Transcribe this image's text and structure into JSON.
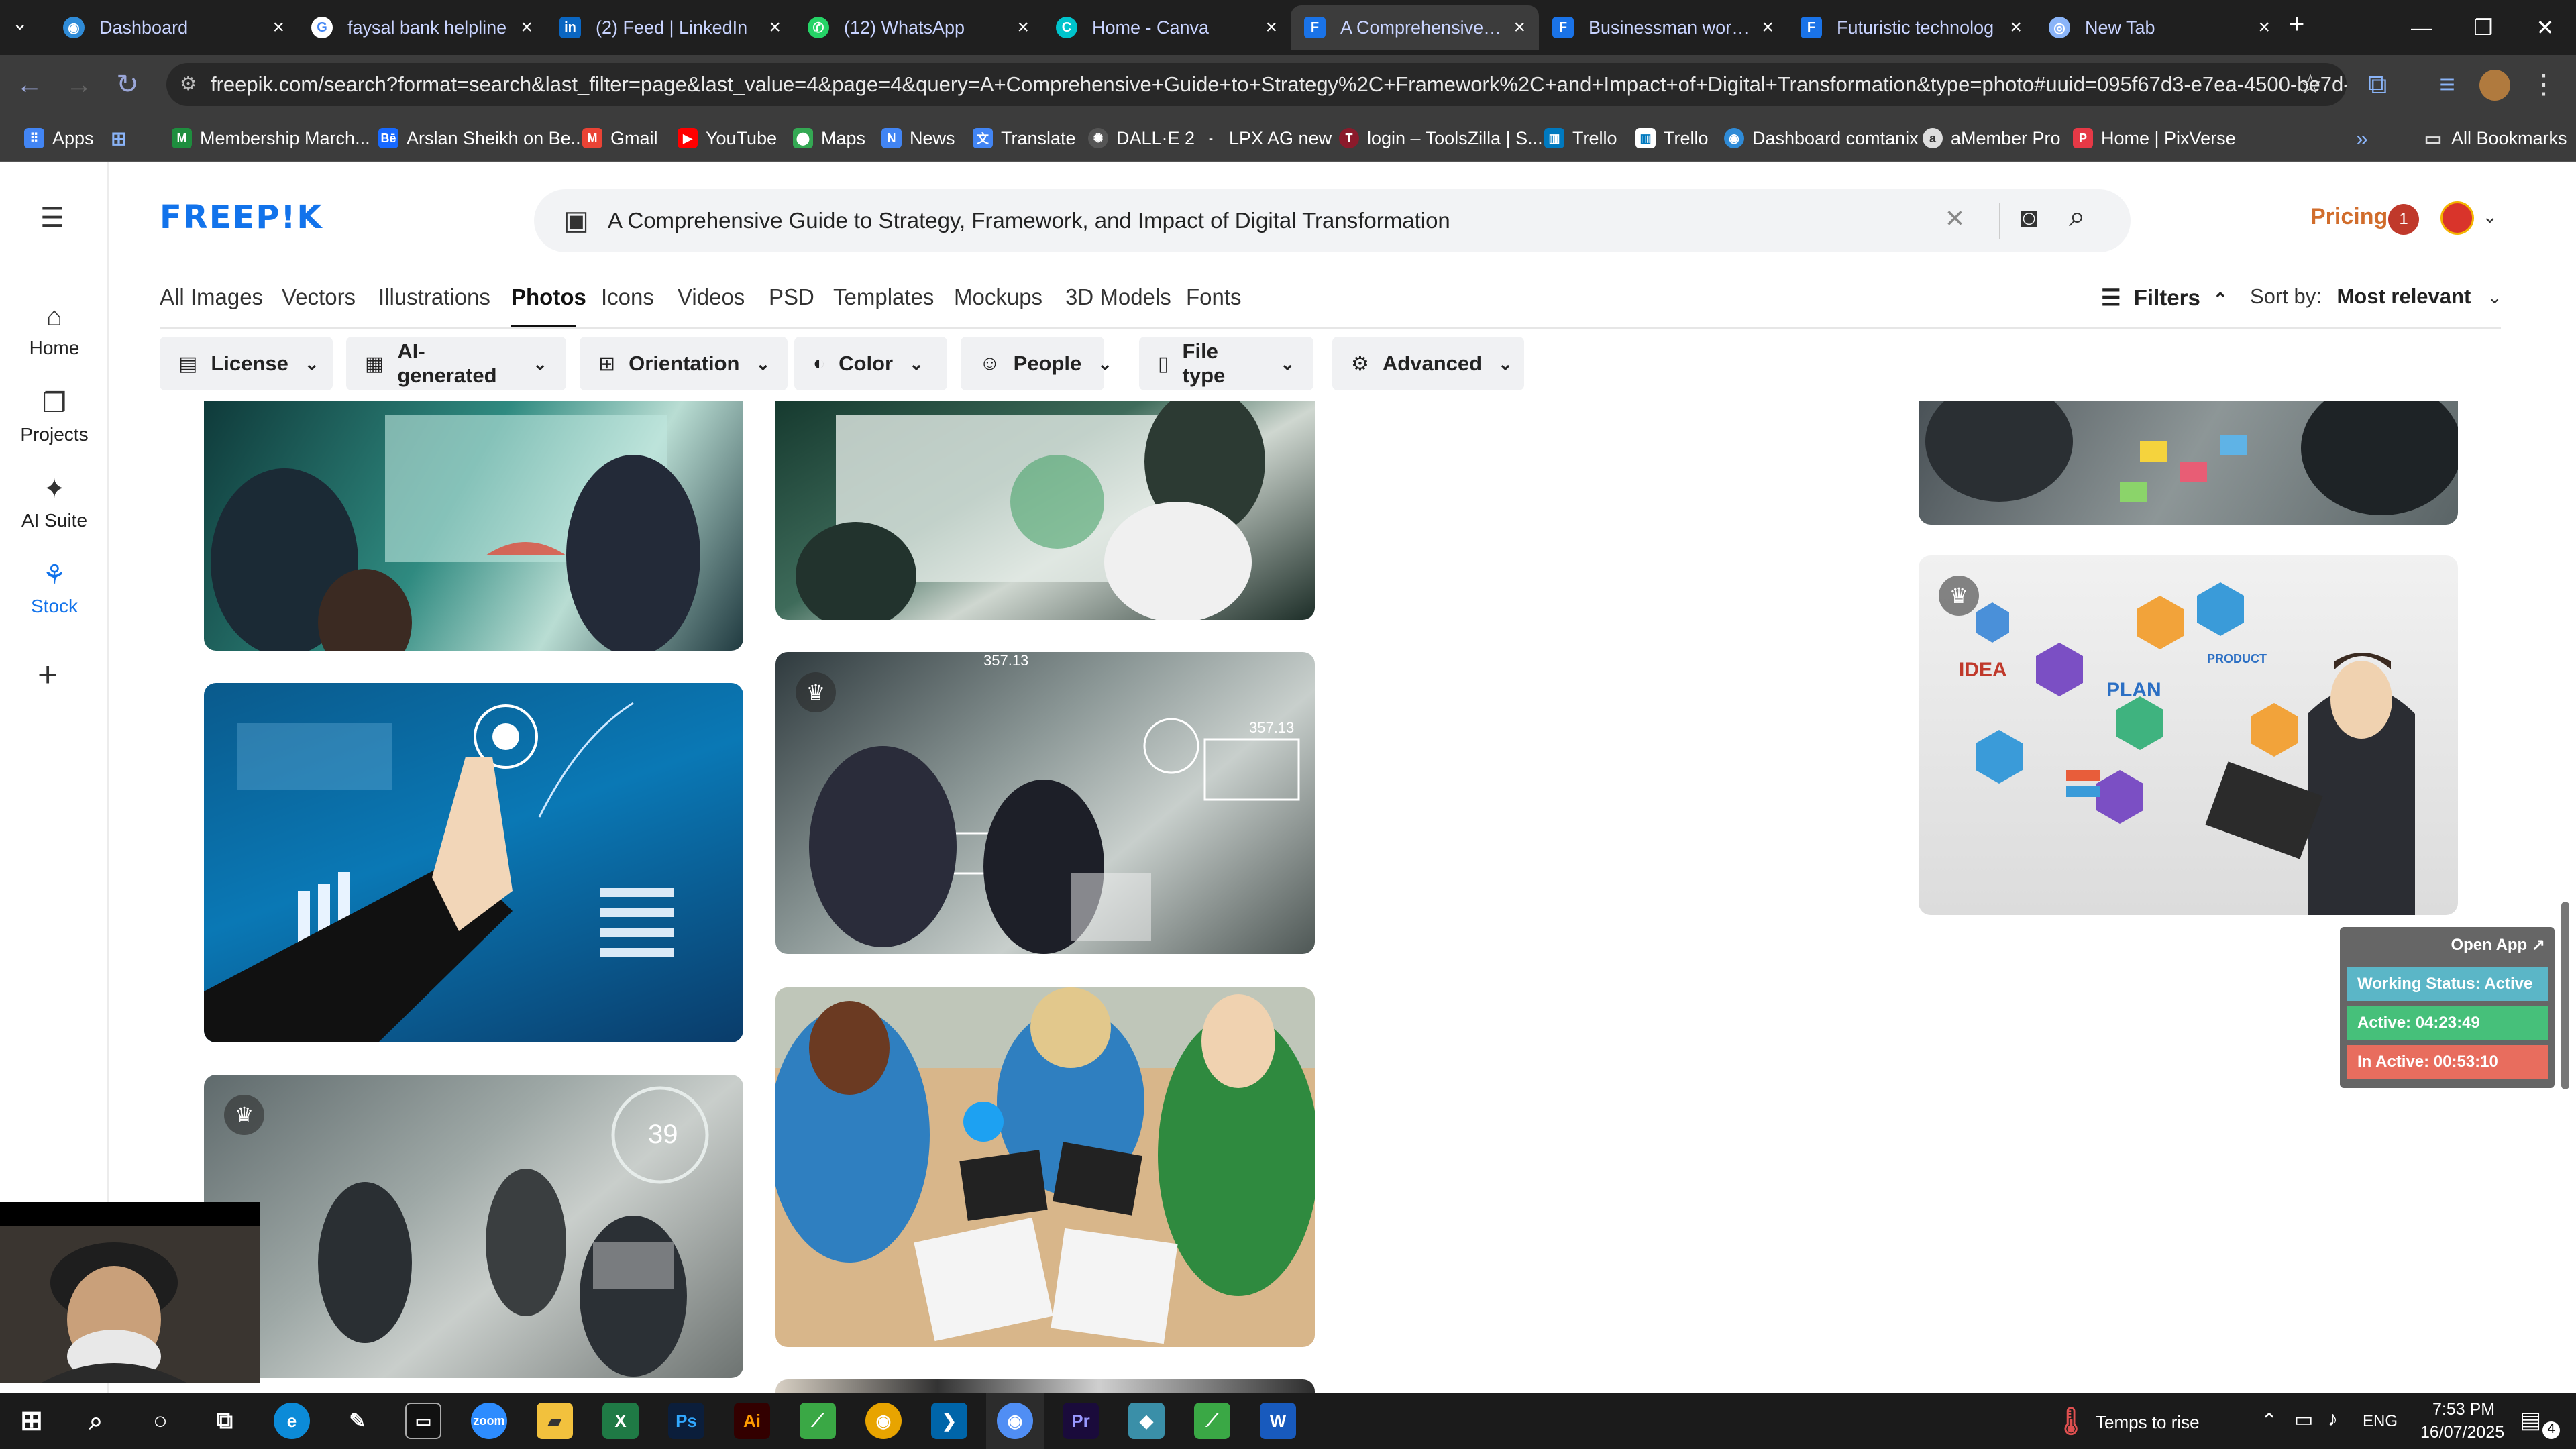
{
  "browser": {
    "tabs": [
      {
        "title": "Dashboard",
        "icon": "dashboard-icon",
        "color": "#2f8bd7"
      },
      {
        "title": "faysal bank helpline",
        "icon": "google-icon",
        "color": "#4285f4"
      },
      {
        "title": "(2) Feed | LinkedIn",
        "icon": "linkedin-icon",
        "color": "#0a66c2"
      },
      {
        "title": "(12) WhatsApp",
        "icon": "whatsapp-icon",
        "color": "#25d366"
      },
      {
        "title": "Home - Canva",
        "icon": "canva-icon",
        "color": "#00c4cc"
      },
      {
        "title": "A Comprehensive Gu",
        "icon": "docs-icon",
        "color": "#1a73e8"
      },
      {
        "title": "Businessman working",
        "icon": "docs-icon",
        "color": "#1a73e8"
      },
      {
        "title": "Futuristic technolog",
        "icon": "docs-icon",
        "color": "#1a73e8"
      },
      {
        "title": "New Tab",
        "icon": "chrome-icon",
        "color": "#8ab4f8"
      }
    ],
    "url": "freepik.com/search?format=search&last_filter=page&last_value=4&page=4&query=A+Comprehensive+Guide+to+Strategy%2C+Framework%2C+and+Impact+of+Digital+Transformation&type=photo#uuid=095f67d3-e7ea-4500-be7d-a48bfbc88e...",
    "bookmarks": [
      {
        "label": "Apps",
        "icon": "apps-icon",
        "color": "#4285f4"
      },
      {
        "label": "",
        "icon": "grid-icon",
        "color": "#8ab4f8"
      },
      {
        "label": "Membership March...",
        "icon": "bookmark-icon",
        "color": "#1e8e3e"
      },
      {
        "label": "Arslan Sheikh on Be...",
        "icon": "behance-icon",
        "color": "#1769ff"
      },
      {
        "label": "Gmail",
        "icon": "gmail-icon",
        "color": "#ea4335"
      },
      {
        "label": "YouTube",
        "icon": "youtube-icon",
        "color": "#ff0000"
      },
      {
        "label": "Maps",
        "icon": "maps-icon",
        "color": "#34a853"
      },
      {
        "label": "News",
        "icon": "news-icon",
        "color": "#4285f4"
      },
      {
        "label": "Translate",
        "icon": "translate-icon",
        "color": "#4285f4"
      },
      {
        "label": "DALL·E 2",
        "icon": "openai-icon",
        "color": "#555555"
      },
      {
        "label": "LPX AG new",
        "icon": "bookmark-icon",
        "color": "#3c3c3c"
      },
      {
        "label": "login – ToolsZilla | S...",
        "icon": "toolszilla-icon",
        "color": "#8b1a2b"
      },
      {
        "label": "Trello",
        "icon": "trello-icon",
        "color": "#0079bf"
      },
      {
        "label": "Trello",
        "icon": "trello-icon",
        "color": "#ffffff"
      },
      {
        "label": "Dashboard comtanix",
        "icon": "dashboard-icon",
        "color": "#2f8bd7"
      },
      {
        "label": "aMember Pro",
        "icon": "amember-icon",
        "color": "#dddddd"
      },
      {
        "label": "Home | PixVerse",
        "icon": "pixverse-icon",
        "color": "#e63946"
      }
    ],
    "all_bookmarks": "All Bookmarks"
  },
  "freepik": {
    "logo": "FREEP!K",
    "search_query": "A Comprehensive Guide to Strategy, Framework, and Impact of Digital Transformation",
    "pricing": "Pricing",
    "notification_count": "1",
    "sidebar": [
      {
        "label": "Home",
        "icon": "home-icon"
      },
      {
        "label": "Projects",
        "icon": "projects-icon"
      },
      {
        "label": "AI Suite",
        "icon": "ai-suite-icon"
      },
      {
        "label": "Stock",
        "icon": "stock-icon"
      }
    ],
    "type_tabs": [
      "All Images",
      "Vectors",
      "Illustrations",
      "Photos",
      "Icons",
      "Videos",
      "PSD",
      "Templates",
      "Mockups",
      "3D Models",
      "Fonts"
    ],
    "active_tab": "Photos",
    "filters_label": "Filters",
    "sort_label": "Sort by:",
    "sort_value": "Most relevant",
    "filter_chips": [
      {
        "label": "License",
        "icon": "license-icon"
      },
      {
        "label": "AI-generated",
        "icon": "ai-generated-icon"
      },
      {
        "label": "Orientation",
        "icon": "orientation-icon"
      },
      {
        "label": "Color",
        "icon": "color-icon"
      },
      {
        "label": "People",
        "icon": "people-icon"
      },
      {
        "label": "File type",
        "icon": "file-type-icon"
      },
      {
        "label": "Advanced",
        "icon": "advanced-icon"
      }
    ]
  },
  "results": {
    "card_texts": {
      "crowd_chart_value_1": "357.13",
      "crowd_chart_value_2": "357.13",
      "circle_value": "39",
      "wall_labels": [
        "IDEA",
        "PLAN",
        "PRODUCT"
      ]
    }
  },
  "work_status": {
    "open_app": "Open App ↗",
    "status": "Working Status: Active",
    "active": "Active: 04:23:49",
    "inactive": "In Active: 00:53:10",
    "colors": {
      "status": "#5bb6c7",
      "active": "#46c07a",
      "inactive": "#e86d5e"
    }
  },
  "taskbar": {
    "weather": "Temps to rise",
    "language": "ENG",
    "time": "7:53 PM",
    "date": "16/07/2025",
    "notification_count": "4"
  }
}
